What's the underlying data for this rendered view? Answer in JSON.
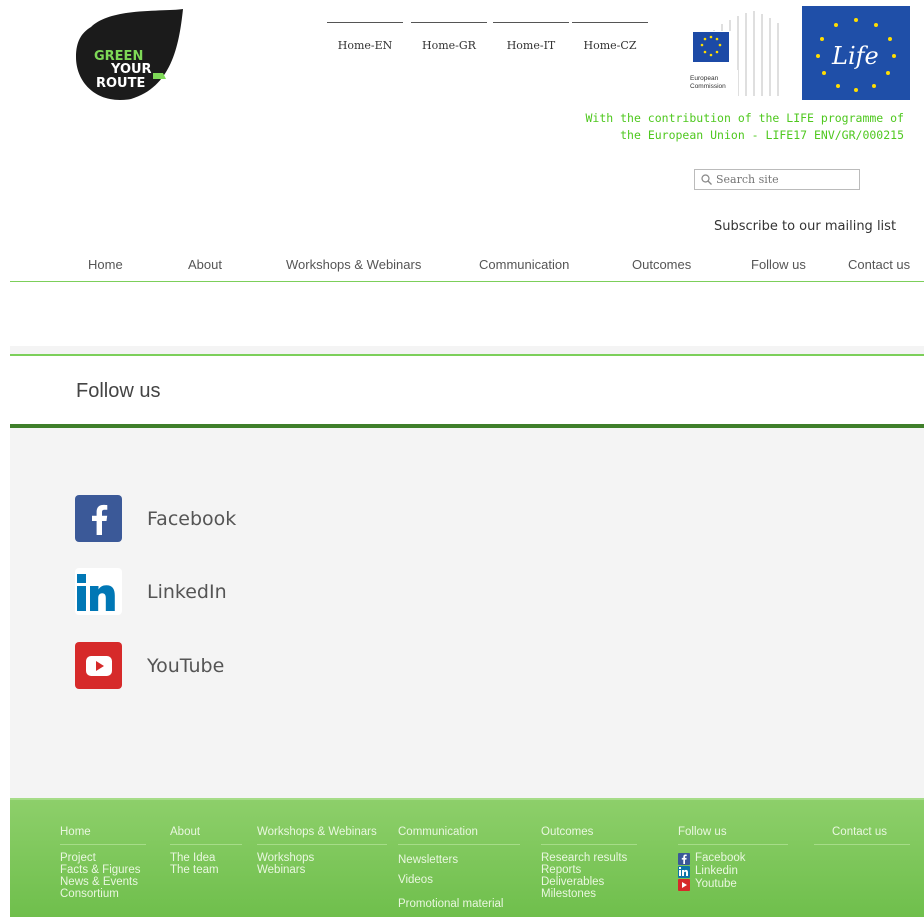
{
  "logo": {
    "text_line1": "GREEN",
    "text_line2": "YOUR",
    "text_line3": "ROUTE"
  },
  "languages": [
    "Home-EN",
    "Home-GR",
    "Home-IT",
    "Home-CZ"
  ],
  "ec_logo": {
    "line1": "European",
    "line2": "Commission"
  },
  "life_logo": {
    "text": "Life"
  },
  "contribution": {
    "line1": "With the contribution of the LIFE programme of",
    "line2": "the European Union - LIFE17 ENV/GR/000215"
  },
  "search": {
    "placeholder": "Search site"
  },
  "subscribe": "Subscribe to our mailing list",
  "nav": [
    "Home",
    "About",
    "Workshops & Webinars",
    "Communication",
    "Outcomes",
    "Follow us",
    "Contact us"
  ],
  "page_title": "Follow us",
  "social": [
    {
      "label": "Facebook",
      "icon": "facebook-icon",
      "color": "#3b5998"
    },
    {
      "label": "LinkedIn",
      "icon": "linkedin-icon",
      "color": "#0077b5"
    },
    {
      "label": "YouTube",
      "icon": "youtube-icon",
      "color": "#d62a2a"
    }
  ],
  "footer": {
    "home": {
      "title": "Home",
      "links": [
        "Project",
        "Facts & Figures",
        "News & Events",
        "Consortium"
      ]
    },
    "about": {
      "title": "About",
      "links": [
        "The Idea",
        "The team"
      ]
    },
    "workshops": {
      "title": "Workshops & Webinars",
      "links": [
        "Workshops",
        "Webinars"
      ]
    },
    "communication": {
      "title": "Communication",
      "links": [
        "Newsletters",
        "Videos",
        "Promotional material"
      ]
    },
    "outcomes": {
      "title": "Outcomes",
      "links": [
        "Research results",
        "Reports",
        "Deliverables",
        "Milestones"
      ]
    },
    "follow": {
      "title": "Follow us",
      "links": [
        "Facebook",
        "Linkedin",
        "Youtube"
      ]
    },
    "contact": {
      "title": "Contact us"
    }
  },
  "colors": {
    "accent_green": "#4fc81f",
    "footer_green": "#7cc85a",
    "dark_green": "#3f7f2a"
  }
}
